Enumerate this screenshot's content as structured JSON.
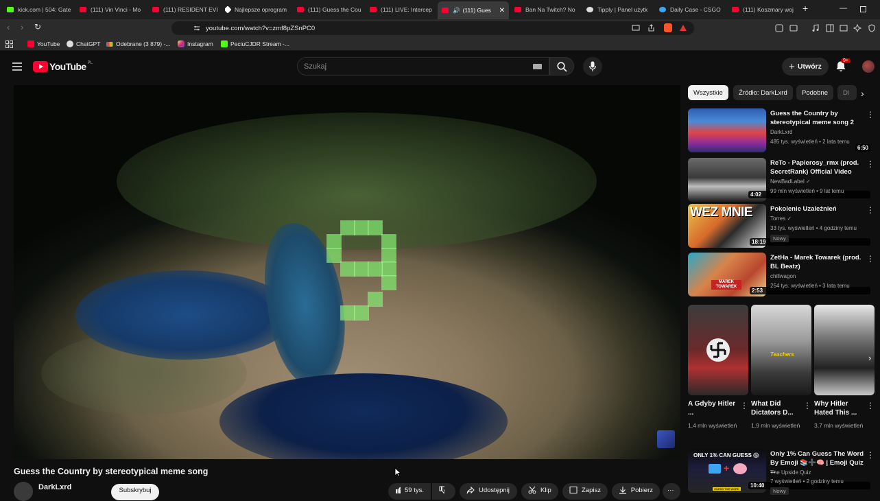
{
  "browser": {
    "tabs": [
      {
        "label": "kick.com | 504: Gate",
        "color": "#53fc18"
      },
      {
        "label": "(111) Vin Vinci - Mo",
        "color": "#ff0033"
      },
      {
        "label": "(111) RESIDENT EVI",
        "color": "#ff0033"
      },
      {
        "label": "Najlepsze oprogram",
        "color": "#ffffff"
      },
      {
        "label": "(111) Guess the Cou",
        "color": "#ff0033"
      },
      {
        "label": "(111) LIVE: Intercep",
        "color": "#ff0033"
      },
      {
        "label": "(111) Gues",
        "color": "#ff0033"
      },
      {
        "label": "Ban Na Twitch? No",
        "color": "#ff0033"
      },
      {
        "label": "Tipply | Panel użytk",
        "color": "#dddddd"
      },
      {
        "label": "Daily Case - CSGO",
        "color": "#3da5f4"
      },
      {
        "label": "(111) Koszmary woj",
        "color": "#ff0033"
      }
    ],
    "new_tab": "+",
    "url": "youtube.com/watch?v=zmf8pZSnPC0",
    "bookmarks": [
      {
        "label": "YouTube",
        "color": "#ff0033"
      },
      {
        "label": "ChatGPT",
        "color": "#dddddd"
      },
      {
        "label": "Odebrane (3 879) -...",
        "color": "#ea4335"
      },
      {
        "label": "Instagram",
        "color": "#e1306c"
      },
      {
        "label": "PeciuCJDR Stream -...",
        "color": "#53fc18"
      }
    ]
  },
  "header": {
    "logo_text": "YouTube",
    "country_code": "PL",
    "search_placeholder": "Szukaj",
    "create_label": "Utwórz",
    "notifications_count": "9+"
  },
  "video": {
    "title": "Guess the Country by stereotypical meme song",
    "channel": "DarkLxrd",
    "subscribe_label": "Subskrybuj",
    "actions": {
      "likes": "59 tys.",
      "share": "Udostępnij",
      "clip": "Klip",
      "save": "Zapisz",
      "download": "Pobierz",
      "more": "···"
    }
  },
  "chips": [
    "Wszystkie",
    "Źródło: DarkLxrd",
    "Podobne",
    "Dl"
  ],
  "recommendations": [
    {
      "title": "Guess the Country by stereotypical meme song 2",
      "channel": "DarkLxrd",
      "meta": "485 tys. wyświetleń • 2 lata temu",
      "duration": "6:50",
      "badge": ""
    },
    {
      "title": "ReTo - Papierosy_rmx (prod. SecretRank) Official Video",
      "channel": "NewBadLabel ✓",
      "meta": "99 mln wyświetleń • 9 lat temu",
      "duration": "4:02",
      "badge": ""
    },
    {
      "title": "Pokolenie Uzależnień",
      "channel": "Torres ✓",
      "meta": "33 tys. wyświetleń • 4 godziny temu",
      "duration": "18:19",
      "badge": "Nowy"
    },
    {
      "title": "ZetHa - Marek Towarek (prod. BL Beatz)",
      "channel": "chillwagon",
      "meta": "254 tys. wyświetleń • 3 lata temu",
      "duration": "2:53",
      "badge": ""
    },
    {
      "title": "Only 1% Can Guess The Word By Emoji 📚➕🧠 | Emoji Quiz ...",
      "channel": "The Upside Quiz",
      "meta": "7 wyświetleń • 2 godziny temu",
      "duration": "10:40",
      "badge": "Nowy"
    }
  ],
  "thumb_texts": {
    "rec2": "WEZ MNIE",
    "rec3": "MAREK TOWAREK",
    "rec5_top": "ONLY 1% CAN GUESS 😱",
    "rec5_bottom": "GUESS THE WORD",
    "short2_caption": "Teachers"
  },
  "shorts": [
    {
      "title": "A Gdyby Hitler ...",
      "views": "1,4 mln wyświetleń"
    },
    {
      "title": "What Did Dictators D...",
      "views": "1,9 mln wyświetleń"
    },
    {
      "title": "Why Hitler Hated This ...",
      "views": "3,7 mln wyświetleń"
    }
  ]
}
